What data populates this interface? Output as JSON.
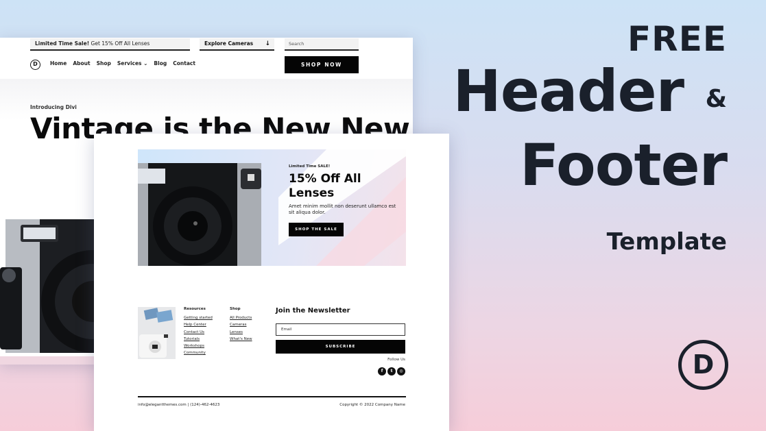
{
  "colors": {
    "ink": "#1a202b",
    "black": "#050505",
    "bg_top": "#cde3f6",
    "bg_bottom": "#f6cdd9"
  },
  "headline": {
    "free": "FREE",
    "header": "Header",
    "ampersand": "&",
    "footer": "Footer",
    "template": "Template",
    "logo_letter": "D"
  },
  "header_preview": {
    "promo_bold": "Limited Time Sale!",
    "promo_text": " Get 15% Off All Lenses",
    "explore_label": "Explore Cameras",
    "explore_arrow_icon": "arrow-down",
    "search_placeholder": "Search",
    "logo_letter": "D",
    "nav": [
      "Home",
      "About",
      "Shop",
      "Services ⌄",
      "Blog",
      "Contact"
    ],
    "cta": "SHOP NOW",
    "intro": "Introducing Divi",
    "title": "Vintage is the New New"
  },
  "footer_preview": {
    "banner": {
      "eyebrow": "Limited Time SALE!",
      "title": "15% Off All Lenses",
      "text": "Amet minim mollit non deserunt ullamco est sit aliqua dolor.",
      "button": "SHOP THE SALE"
    },
    "resources": {
      "heading": "Resources",
      "links": [
        "Getting started",
        "Help Center",
        "Contact Us",
        "Tutorials",
        "Workshops",
        "Community"
      ]
    },
    "shop": {
      "heading": "Shop",
      "links": [
        "All Products",
        "Cameras",
        "Lenses",
        "What's New"
      ]
    },
    "newsletter": {
      "title": "Join the Newsletter",
      "email_placeholder": "Email",
      "button": "SUBSCRIBE",
      "follow": "Follow Us",
      "socials": [
        "facebook",
        "twitter",
        "instagram"
      ],
      "social_glyphs": [
        "f",
        "t",
        "◎"
      ]
    },
    "contact": "info@elegantthemes.com  |  (124)-462-4623",
    "copyright": "Copyright © 2022 Company Name"
  }
}
